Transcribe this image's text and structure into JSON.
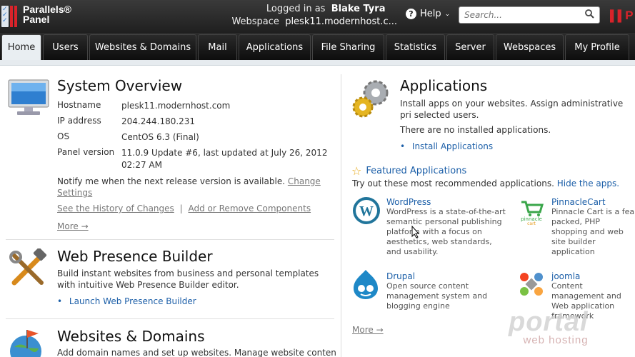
{
  "header": {
    "logo_line1": "Parallels®",
    "logo_line2": "Panel",
    "logged_in_label": "Logged in as",
    "user_name": "Blake Tyra",
    "webspace_label": "Webspace",
    "webspace_value": "plesk11.modernhost.c...",
    "help_label": "Help",
    "search_placeholder": "Search...",
    "right_logo": "P"
  },
  "nav": {
    "tabs": [
      {
        "label": "Home",
        "active": true
      },
      {
        "label": "Users"
      },
      {
        "label": "Websites & Domains"
      },
      {
        "label": "Mail"
      },
      {
        "label": "Applications"
      },
      {
        "label": "File Sharing"
      },
      {
        "label": "Statistics"
      },
      {
        "label": "Server"
      },
      {
        "label": "Webspaces"
      },
      {
        "label": "My Profile"
      }
    ]
  },
  "system_overview": {
    "title": "System Overview",
    "rows": [
      {
        "key": "Hostname",
        "value": "plesk11.modernhost.com"
      },
      {
        "key": "IP address",
        "value": "204.244.180.231"
      },
      {
        "key": "OS",
        "value": "CentOS 6.3 (Final)"
      },
      {
        "key": "Panel version",
        "value": "11.0.9 Update #6, last updated at July 26, 2012 02:27 AM"
      }
    ],
    "notify_text": "Notify me when the next release version is available.",
    "change_settings": "Change Settings",
    "history_link": "See the History of Changes",
    "separator": "|",
    "components_link": "Add or Remove Components",
    "more": "More →"
  },
  "web_presence": {
    "title": "Web Presence Builder",
    "description": "Build instant websites from business and personal templates with intuitive Web Presence Builder editor.",
    "launch_link": "Launch Web Presence Builder"
  },
  "websites_domains": {
    "title": "Websites & Domains",
    "description": "Add domain names and set up websites. Manage website content"
  },
  "applications": {
    "title": "Applications",
    "description": "Install apps on your websites. Assign administrative pri selected users.",
    "none_text": "There are no installed applications.",
    "install_link": "Install Applications",
    "featured_title": "Featured Applications",
    "try_text": "Try out these most recommended applications.",
    "hide_link": "Hide the apps.",
    "apps": [
      {
        "name": "WordPress",
        "desc": "WordPress is a state-of-the-art semantic personal publishing platform with a focus on aesthetics, web standards, and usability."
      },
      {
        "name": "PinnacleCart",
        "desc": "Pinnacle Cart is a fea packed, PHP shopping and web site builder application"
      },
      {
        "name": "Drupal",
        "desc": "Open source content management system and blogging engine"
      },
      {
        "name": "joomla",
        "desc": "Content management and Web application framework"
      }
    ],
    "more": "More →"
  },
  "watermark": {
    "line1": "portal",
    "line2": "web hosting"
  }
}
